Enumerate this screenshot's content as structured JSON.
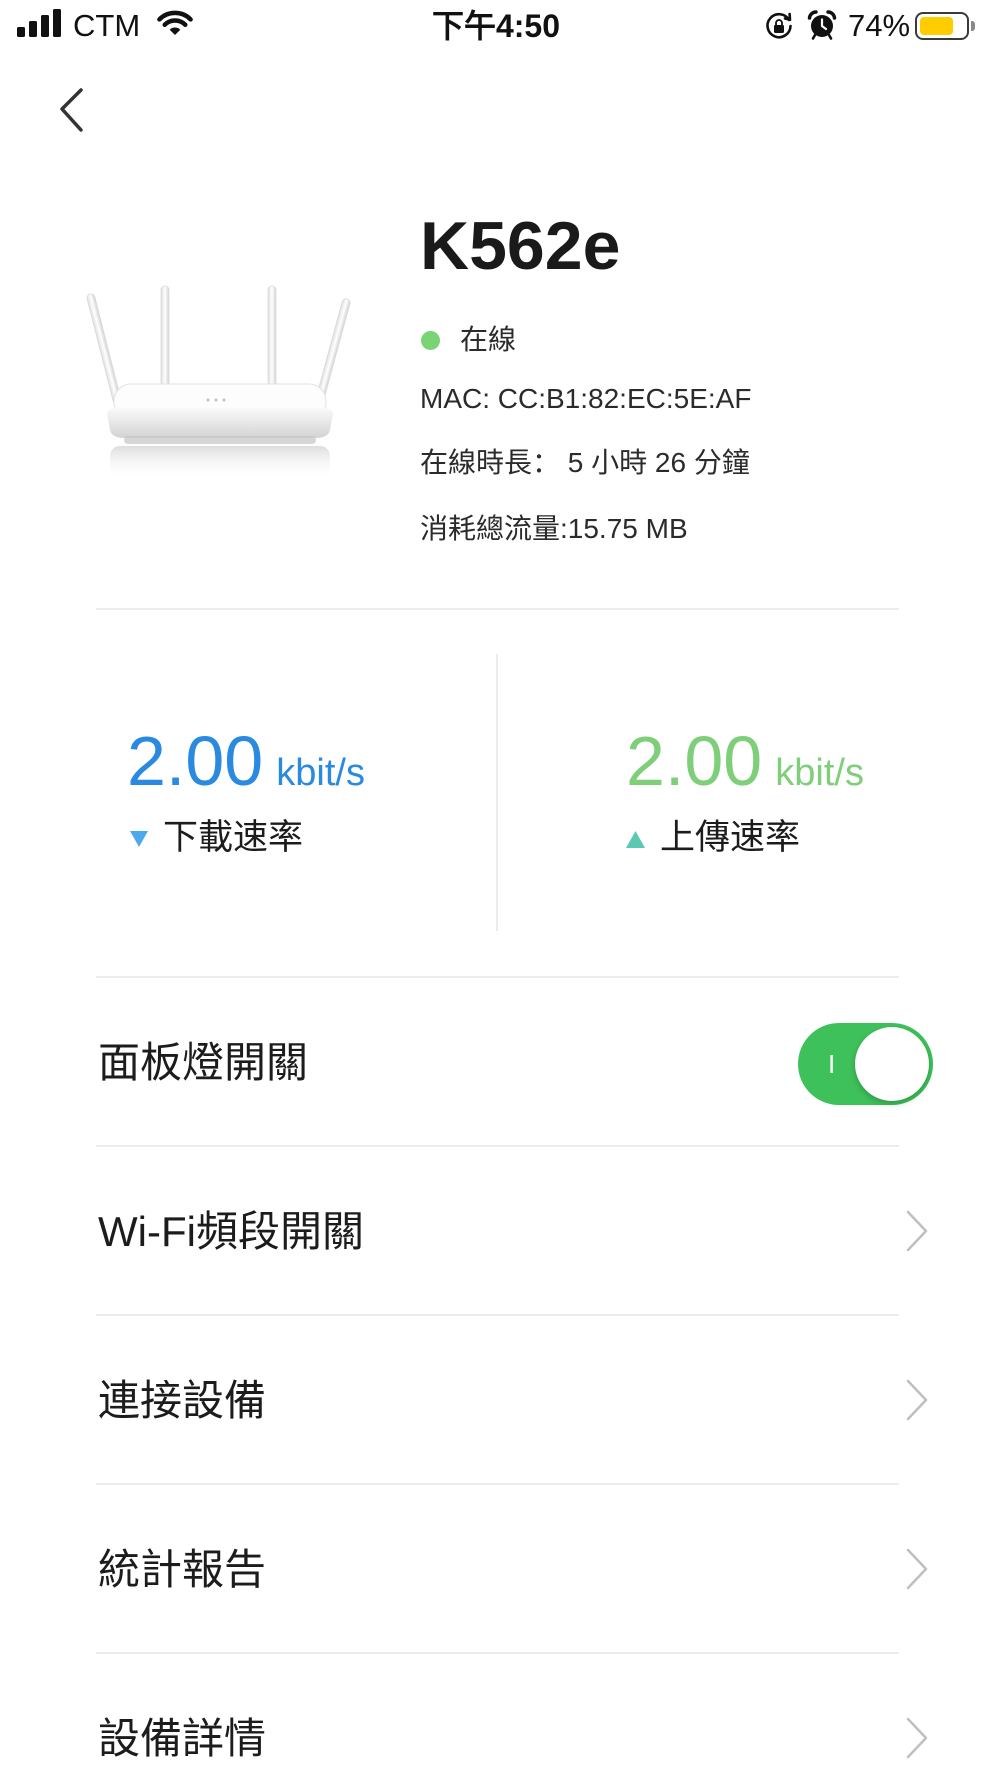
{
  "status_bar": {
    "carrier": "CTM",
    "signal_bars": 4,
    "time": "下午4:50",
    "battery_percent": "74%",
    "battery_level": 0.74,
    "battery_fill_color": "#FFCC00",
    "icons": {
      "signal": "signal-icon",
      "wifi": "wifi-icon",
      "rotation_lock": "rotation-lock-icon",
      "alarm": "alarm-icon",
      "battery": "battery-icon"
    }
  },
  "nav": {
    "back_icon": "chevron-left-icon"
  },
  "device": {
    "name": "K562e",
    "status": "在線",
    "status_color": "#7AD374",
    "mac": "MAC: CC:B1:82:EC:5E:AF",
    "online_duration": "在線時長： 5 小時 26 分鐘",
    "total_traffic": "消耗總流量:15.75 MB"
  },
  "speeds": {
    "download": {
      "value": "2.00",
      "unit": "kbit/s",
      "label": "下載速率",
      "icon": "down-triangle-icon",
      "value_color": "#2A8AE0",
      "icon_color": "#4DA9EC"
    },
    "upload": {
      "value": "2.00",
      "unit": "kbit/s",
      "label": "上傳速率",
      "icon": "up-triangle-icon",
      "value_color": "#7FCF7A",
      "icon_color": "#5BC9B1"
    }
  },
  "settings": {
    "toggle_on_color": "#3EC15A",
    "rows": [
      {
        "label": "面板燈開關",
        "toggle": {
          "enabled": true,
          "on_glyph": "I"
        }
      },
      {
        "label": "Wi-Fi頻段開關",
        "icon": "chevron-right-icon"
      },
      {
        "label": "連接設備",
        "icon": "chevron-right-icon"
      },
      {
        "label": "統計報告",
        "icon": "chevron-right-icon"
      },
      {
        "label": "設備詳情",
        "icon": "chevron-right-icon"
      }
    ]
  }
}
